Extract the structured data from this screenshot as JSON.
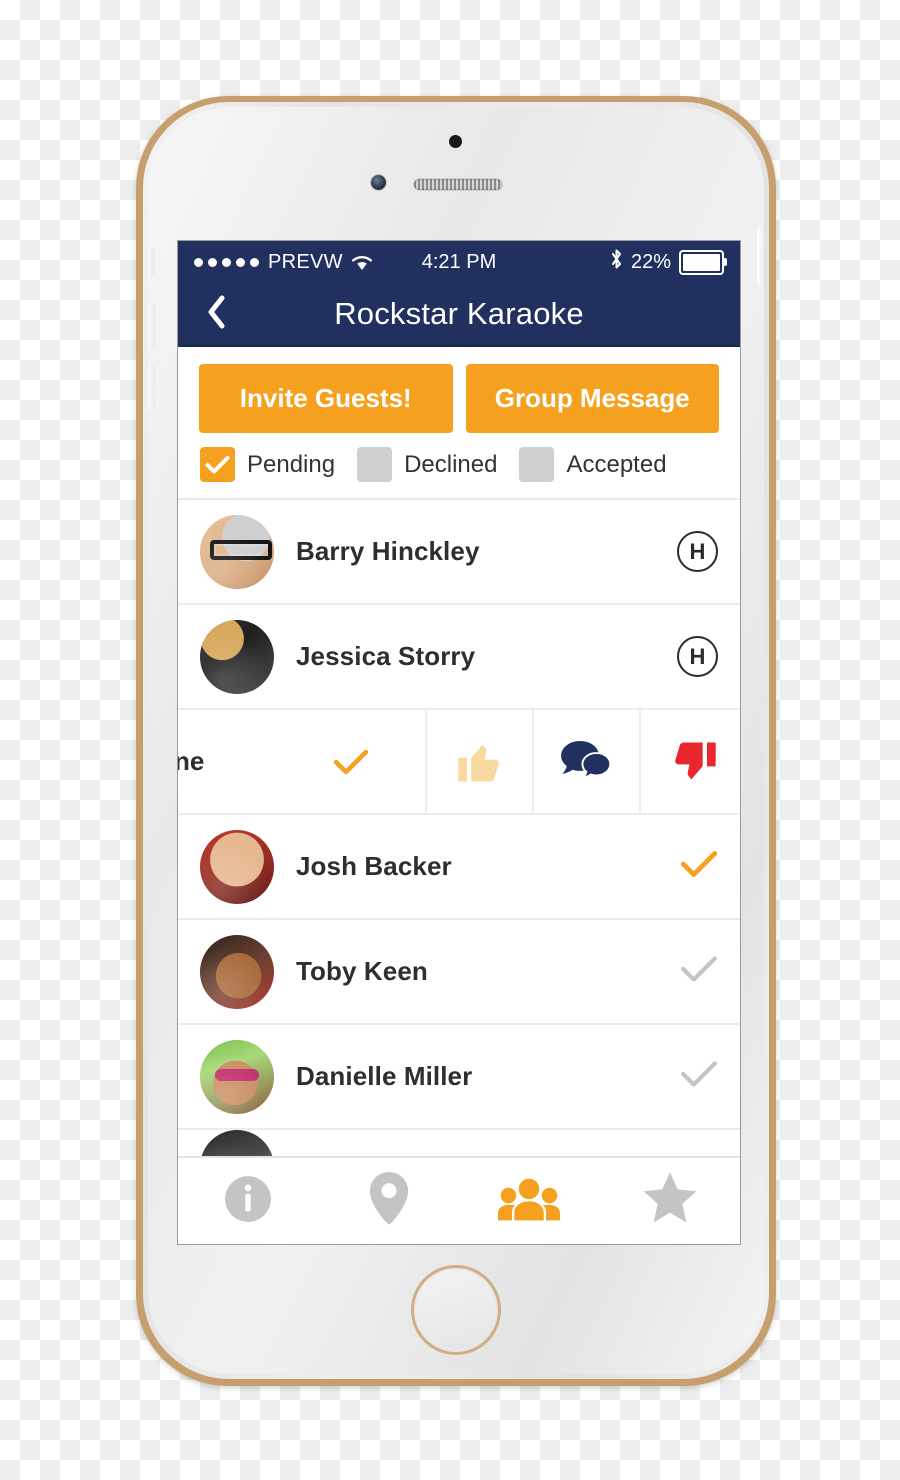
{
  "colors": {
    "navy": "#22305f",
    "orange": "#f5a01e",
    "orange_light": "#fad9a0",
    "red": "#e8272c",
    "gray_check": "#c4c4c4",
    "gray_box": "#cfcfcf",
    "bezel_gold": "#c79e6e"
  },
  "status_bar": {
    "signal_dots": 5,
    "carrier": "PREVW",
    "wifi_icon": "wifi-icon",
    "time": "4:21 PM",
    "bluetooth_icon": "bluetooth-icon",
    "battery_percent": "22%",
    "battery_icon": "battery-icon"
  },
  "nav_bar": {
    "back_icon": "chevron-left-icon",
    "title": "Rockstar Karaoke"
  },
  "actions": {
    "invite_label": "Invite Guests!",
    "group_message_label": "Group Message"
  },
  "filters": [
    {
      "label": "Pending",
      "checked": true
    },
    {
      "label": "Declined",
      "checked": false
    },
    {
      "label": "Accepted",
      "checked": false
    }
  ],
  "guests": [
    {
      "name": "Barry Hinckley",
      "status_icon": "host-badge",
      "status_label": "H"
    },
    {
      "name": "Jessica Storry",
      "status_icon": "host-badge",
      "status_label": "H"
    },
    {
      "name": "ne",
      "status_icon": "check-icon-orange",
      "swiped": true
    },
    {
      "name": "Josh Backer",
      "status_icon": "check-icon-orange"
    },
    {
      "name": "Toby Keen",
      "status_icon": "check-icon-gray"
    },
    {
      "name": "Danielle Miller",
      "status_icon": "check-icon-gray"
    }
  ],
  "swipe_actions": [
    {
      "name": "thumbs-up-icon",
      "color": "#fad9a0"
    },
    {
      "name": "chat-bubbles-icon",
      "color": "#22305f"
    },
    {
      "name": "thumbs-down-icon",
      "color": "#e8272c"
    }
  ],
  "tab_bar": [
    {
      "name": "info-icon",
      "active": false
    },
    {
      "name": "map-pin-icon",
      "active": false
    },
    {
      "name": "guests-icon",
      "active": true
    },
    {
      "name": "star-icon",
      "active": false
    }
  ]
}
